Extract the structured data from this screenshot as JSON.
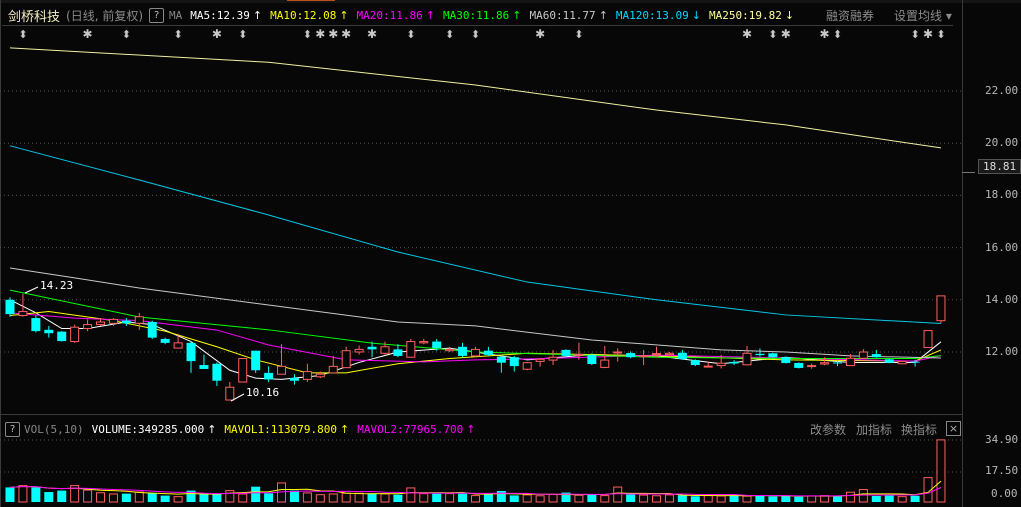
{
  "header": {
    "stock_name": "剑桥科技",
    "period": "(日线, 前复权)",
    "help": "?",
    "ma_label": "MA",
    "ma_items": [
      {
        "label": "MA5:12.39",
        "arrow": "↑",
        "color": "#ffffff"
      },
      {
        "label": "MA10:12.08",
        "arrow": "↑",
        "color": "#ffff00"
      },
      {
        "label": "MA20:11.86",
        "arrow": "↑",
        "color": "#ff00ff"
      },
      {
        "label": "MA30:11.86",
        "arrow": "↑",
        "color": "#00ff00"
      },
      {
        "label": "MA60:11.77",
        "arrow": "↑",
        "color": "#c8c8c8"
      },
      {
        "label": "MA120:13.09",
        "arrow": "↓",
        "color": "#00d8ff"
      },
      {
        "label": "MA250:19.82",
        "arrow": "↓",
        "color": "#ffff99"
      }
    ],
    "margin_trading": "融资融券",
    "set_ma": "设置均线 ▾"
  },
  "price_axis": {
    "ticks": [
      "22.00",
      "20.00",
      "18.00",
      "16.00",
      "14.00",
      "12.00"
    ],
    "tick_values": [
      22,
      20,
      18,
      16,
      14,
      12
    ],
    "current_label": "18.81"
  },
  "annotations": {
    "high": "14.23",
    "low": "10.16"
  },
  "volume_header": {
    "help": "?",
    "label": "VOL(5,10)",
    "items": [
      {
        "label": "VOLUME:349285.000",
        "arrow": "↑",
        "color": "#ffffff"
      },
      {
        "label": "MAVOL1:113079.800",
        "arrow": "↑",
        "color": "#ffff00"
      },
      {
        "label": "MAVOL2:77965.700",
        "arrow": "↑",
        "color": "#ff00ff"
      }
    ],
    "buttons": [
      "改参数",
      "加指标",
      "换指标"
    ],
    "close": "×"
  },
  "volume_axis": {
    "ticks": [
      "34.90",
      "17.50",
      "0.00"
    ],
    "tick_values": [
      34.9,
      17.5,
      0
    ]
  },
  "colors": {
    "up": "#ff5f5f",
    "down": "#00ffff",
    "bg": "#070707",
    "grid": "#555555"
  },
  "markers": [
    {
      "i": 1,
      "type": "info"
    },
    {
      "i": 6,
      "type": "event"
    },
    {
      "i": 9,
      "type": "info"
    },
    {
      "i": 13,
      "type": "info"
    },
    {
      "i": 16,
      "type": "event"
    },
    {
      "i": 18,
      "type": "info"
    },
    {
      "i": 23,
      "type": "info"
    },
    {
      "i": 24,
      "type": "event"
    },
    {
      "i": 25,
      "type": "event"
    },
    {
      "i": 26,
      "type": "event"
    },
    {
      "i": 28,
      "type": "event"
    },
    {
      "i": 31,
      "type": "info"
    },
    {
      "i": 34,
      "type": "info"
    },
    {
      "i": 36,
      "type": "info"
    },
    {
      "i": 41,
      "type": "event"
    },
    {
      "i": 44,
      "type": "info"
    },
    {
      "i": 57,
      "type": "event"
    },
    {
      "i": 59,
      "type": "info"
    },
    {
      "i": 60,
      "type": "event"
    },
    {
      "i": 63,
      "type": "event"
    },
    {
      "i": 64,
      "type": "info"
    },
    {
      "i": 70,
      "type": "info"
    },
    {
      "i": 71,
      "type": "event"
    },
    {
      "i": 72,
      "type": "info"
    }
  ],
  "chart_data": {
    "type": "candlestick",
    "ylim": [
      9.9,
      24.2
    ],
    "ohlc": [
      [
        14.0,
        14.1,
        13.35,
        13.45
      ],
      [
        13.4,
        14.23,
        13.35,
        13.55
      ],
      [
        13.3,
        13.4,
        12.75,
        12.8
      ],
      [
        12.85,
        13.0,
        12.55,
        12.72
      ],
      [
        12.78,
        12.8,
        12.4,
        12.42
      ],
      [
        12.4,
        13.05,
        12.35,
        12.95
      ],
      [
        12.9,
        13.25,
        12.8,
        13.05
      ],
      [
        13.05,
        13.3,
        13.0,
        13.15
      ],
      [
        13.1,
        13.3,
        13.0,
        13.25
      ],
      [
        13.2,
        13.3,
        13.0,
        13.1
      ],
      [
        13.1,
        13.5,
        12.85,
        13.35
      ],
      [
        13.15,
        13.2,
        12.5,
        12.55
      ],
      [
        12.5,
        12.55,
        12.3,
        12.35
      ],
      [
        12.15,
        12.7,
        12.15,
        12.35
      ],
      [
        12.35,
        12.4,
        11.2,
        11.65
      ],
      [
        11.5,
        11.9,
        11.35,
        11.35
      ],
      [
        11.55,
        11.6,
        10.7,
        10.9
      ],
      [
        10.16,
        10.85,
        10.16,
        10.65
      ],
      [
        10.85,
        11.75,
        10.85,
        11.75
      ],
      [
        12.05,
        12.05,
        11.2,
        11.3
      ],
      [
        11.2,
        11.45,
        10.85,
        10.95
      ],
      [
        11.15,
        12.3,
        11.15,
        11.45
      ],
      [
        11.0,
        11.15,
        10.75,
        10.9
      ],
      [
        10.95,
        11.55,
        10.85,
        11.25
      ],
      [
        11.05,
        11.25,
        11.0,
        11.15
      ],
      [
        11.2,
        11.85,
        11.2,
        11.45
      ],
      [
        11.4,
        12.2,
        11.4,
        12.05
      ],
      [
        12.0,
        12.25,
        11.9,
        12.1
      ],
      [
        12.2,
        12.4,
        11.8,
        12.1
      ],
      [
        11.95,
        12.4,
        11.9,
        12.2
      ],
      [
        12.1,
        12.3,
        11.8,
        11.85
      ],
      [
        11.8,
        12.5,
        11.8,
        12.4
      ],
      [
        12.35,
        12.5,
        12.3,
        12.4
      ],
      [
        12.4,
        12.5,
        12.05,
        12.15
      ],
      [
        12.05,
        12.2,
        12.0,
        12.1
      ],
      [
        12.2,
        12.35,
        11.8,
        11.85
      ],
      [
        11.85,
        12.2,
        11.8,
        12.1
      ],
      [
        12.05,
        12.2,
        11.85,
        11.89
      ],
      [
        11.82,
        11.9,
        11.21,
        11.59
      ],
      [
        11.8,
        11.85,
        11.25,
        11.46
      ],
      [
        11.34,
        11.62,
        11.3,
        11.59
      ],
      [
        11.64,
        11.76,
        11.44,
        11.72
      ],
      [
        11.69,
        12.08,
        11.5,
        11.8
      ],
      [
        12.08,
        12.1,
        11.8,
        11.85
      ],
      [
        11.88,
        12.36,
        11.7,
        11.91
      ],
      [
        11.89,
        11.95,
        11.5,
        11.54
      ],
      [
        11.41,
        12.23,
        11.38,
        11.69
      ],
      [
        11.98,
        12.14,
        11.63,
        12.0
      ],
      [
        11.96,
        12.02,
        11.76,
        11.8
      ],
      [
        11.83,
        12.08,
        11.5,
        11.86
      ],
      [
        11.91,
        12.2,
        11.8,
        11.94
      ],
      [
        11.9,
        12.0,
        11.88,
        11.95
      ],
      [
        11.97,
        12.08,
        11.7,
        11.73
      ],
      [
        11.69,
        11.72,
        11.46,
        11.5
      ],
      [
        11.44,
        11.63,
        11.41,
        11.46
      ],
      [
        11.48,
        11.89,
        11.37,
        11.57
      ],
      [
        11.62,
        11.69,
        11.5,
        11.56
      ],
      [
        11.51,
        12.23,
        11.5,
        11.95
      ],
      [
        11.93,
        12.14,
        11.82,
        11.88
      ],
      [
        11.95,
        11.97,
        11.78,
        11.8
      ],
      [
        11.8,
        11.82,
        11.56,
        11.58
      ],
      [
        11.58,
        11.6,
        11.37,
        11.39
      ],
      [
        11.45,
        11.56,
        11.36,
        11.48
      ],
      [
        11.54,
        11.8,
        11.49,
        11.59
      ],
      [
        11.6,
        11.7,
        11.46,
        11.57
      ],
      [
        11.48,
        11.92,
        11.47,
        11.76
      ],
      [
        11.76,
        12.11,
        11.74,
        12.0
      ],
      [
        11.92,
        12.08,
        11.78,
        11.8
      ],
      [
        11.72,
        11.74,
        11.57,
        11.59
      ],
      [
        11.55,
        11.66,
        11.53,
        11.64
      ],
      [
        11.63,
        11.7,
        11.44,
        11.6
      ],
      [
        12.17,
        12.82,
        12.17,
        12.82
      ],
      [
        13.2,
        14.15,
        13.1,
        14.15
      ]
    ],
    "volume": [
      8.2,
      9.2,
      8.2,
      5.6,
      6.4,
      9.2,
      6.7,
      5.2,
      4.5,
      4.7,
      5.6,
      5.1,
      3.6,
      3.0,
      6.4,
      4.5,
      4.5,
      6.4,
      4.5,
      8.6,
      4.9,
      10.7,
      6.4,
      5.1,
      4.1,
      4.5,
      4.9,
      4.9,
      4.9,
      4.5,
      4.1,
      7.9,
      4.7,
      4.7,
      4.7,
      4.7,
      3.6,
      4.5,
      6.2,
      3.7,
      4.0,
      3.5,
      4.2,
      5.3,
      3.8,
      4.1,
      3.6,
      8.4,
      4.2,
      3.9,
      3.5,
      4.0,
      3.8,
      3.2,
      3.6,
      3.4,
      4.0,
      3.3,
      3.7,
      3.1,
      3.5,
      3.0,
      3.4,
      3.6,
      3.2,
      5.5,
      7.0,
      3.4,
      3.6,
      3.0,
      3.5,
      13.7,
      34.9
    ],
    "ma_lines": [
      {
        "name": "MA5",
        "color": "#ffffff",
        "points": [
          [
            0,
            14.0
          ],
          [
            2,
            13.5
          ],
          [
            4,
            12.9
          ],
          [
            6,
            12.9
          ],
          [
            9,
            13.15
          ],
          [
            11,
            13.05
          ],
          [
            14,
            12.4
          ],
          [
            17,
            11.3
          ],
          [
            19,
            11.0
          ],
          [
            21,
            10.95
          ],
          [
            24,
            11.1
          ],
          [
            27,
            11.6
          ],
          [
            30,
            12.0
          ],
          [
            34,
            12.15
          ],
          [
            40,
            11.7
          ],
          [
            45,
            11.9
          ],
          [
            50,
            11.85
          ],
          [
            55,
            11.55
          ],
          [
            60,
            11.8
          ],
          [
            65,
            11.6
          ],
          [
            70,
            11.6
          ],
          [
            72,
            12.39
          ]
        ]
      },
      {
        "name": "MA10",
        "color": "#ffff00",
        "points": [
          [
            0,
            13.4
          ],
          [
            3,
            13.55
          ],
          [
            8,
            13.2
          ],
          [
            12,
            12.8
          ],
          [
            16,
            12.2
          ],
          [
            19,
            11.7
          ],
          [
            23,
            11.2
          ],
          [
            26,
            11.2
          ],
          [
            30,
            11.55
          ],
          [
            34,
            11.75
          ],
          [
            40,
            11.95
          ],
          [
            50,
            11.85
          ],
          [
            60,
            11.7
          ],
          [
            70,
            11.65
          ],
          [
            72,
            12.08
          ]
        ]
      },
      {
        "name": "MA20",
        "color": "#ff00ff",
        "points": [
          [
            0,
            13.5
          ],
          [
            5,
            13.3
          ],
          [
            10,
            13.2
          ],
          [
            16,
            12.84
          ],
          [
            20,
            12.27
          ],
          [
            26,
            11.7
          ],
          [
            32,
            11.62
          ],
          [
            36,
            11.7
          ],
          [
            40,
            11.73
          ],
          [
            50,
            11.88
          ],
          [
            60,
            11.77
          ],
          [
            70,
            11.65
          ],
          [
            72,
            11.86
          ]
        ]
      },
      {
        "name": "MA30",
        "color": "#00ff00",
        "points": [
          [
            0,
            14.37
          ],
          [
            10,
            13.34
          ],
          [
            20,
            12.85
          ],
          [
            28,
            12.34
          ],
          [
            36,
            12.0
          ],
          [
            50,
            11.8
          ],
          [
            60,
            11.75
          ],
          [
            70,
            11.75
          ],
          [
            72,
            11.86
          ]
        ]
      },
      {
        "name": "MA60",
        "color": "#c8c8c8",
        "points": [
          [
            0,
            15.22
          ],
          [
            5,
            14.84
          ],
          [
            10,
            14.45
          ],
          [
            20,
            13.8
          ],
          [
            30,
            13.15
          ],
          [
            36,
            13.0
          ],
          [
            45,
            12.46
          ],
          [
            55,
            12.08
          ],
          [
            60,
            12.0
          ],
          [
            65,
            11.85
          ],
          [
            72,
            11.77
          ]
        ]
      },
      {
        "name": "MA120",
        "color": "#00c8e8",
        "points": [
          [
            0,
            19.9
          ],
          [
            10,
            18.59
          ],
          [
            20,
            17.25
          ],
          [
            30,
            15.83
          ],
          [
            40,
            14.68
          ],
          [
            50,
            14.0
          ],
          [
            60,
            13.42
          ],
          [
            72,
            13.09
          ]
        ]
      },
      {
        "name": "MA250",
        "color": "#f0f0a0",
        "points": [
          [
            0,
            23.65
          ],
          [
            20,
            23.1
          ],
          [
            36,
            22.23
          ],
          [
            50,
            21.27
          ],
          [
            60,
            20.7
          ],
          [
            72,
            19.82
          ]
        ]
      }
    ],
    "mavol_lines": [
      {
        "name": "MAVOL1",
        "color": "#ffff00",
        "period": 5
      },
      {
        "name": "MAVOL2",
        "color": "#ff00ff",
        "period": 10
      }
    ]
  }
}
